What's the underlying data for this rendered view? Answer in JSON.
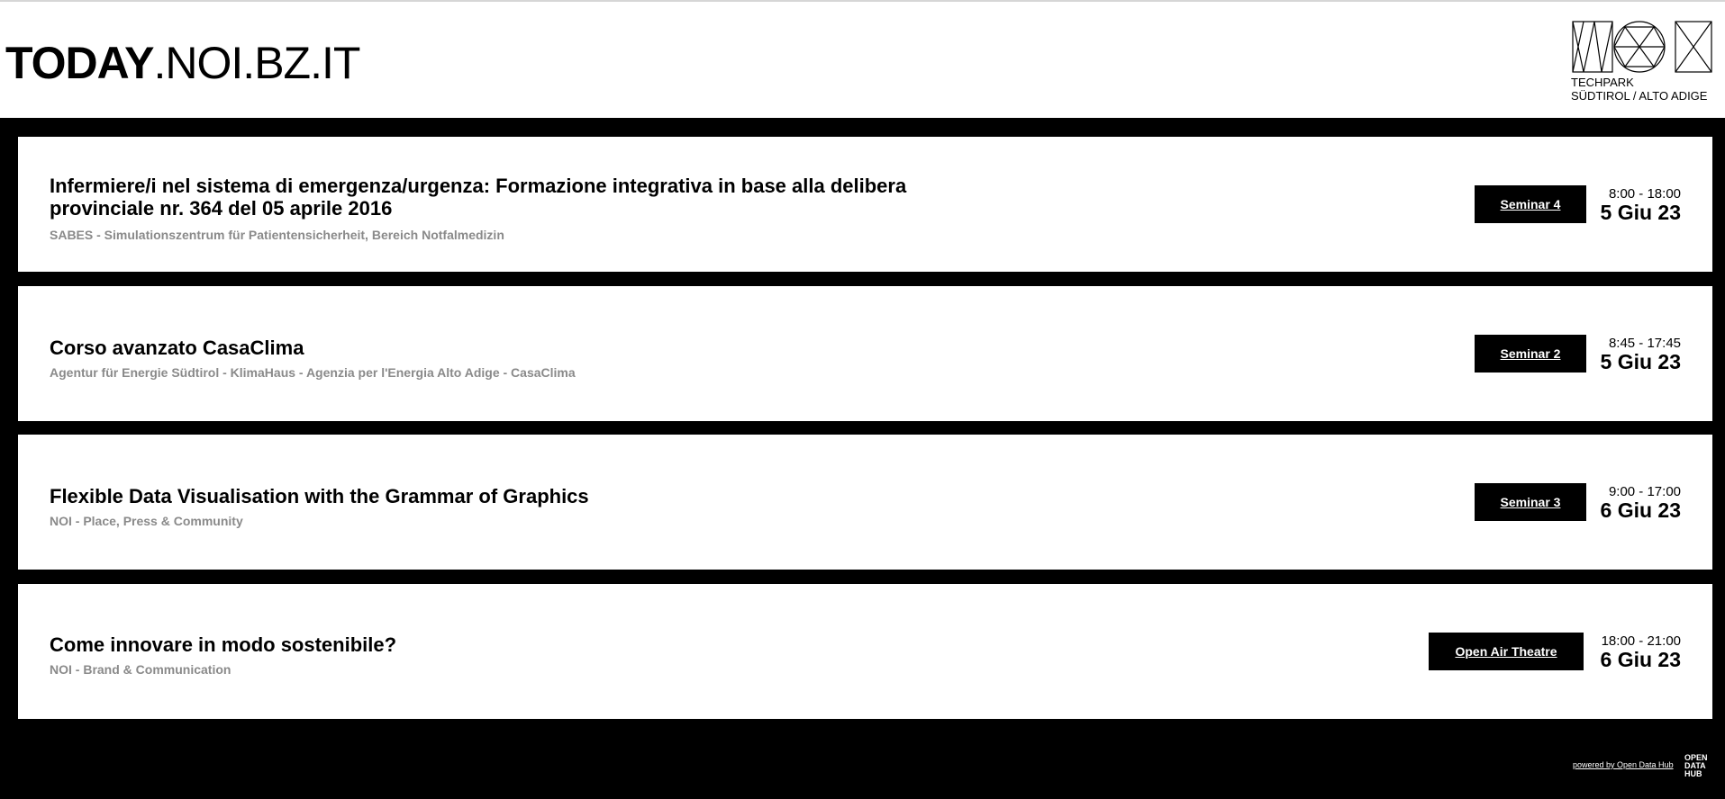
{
  "header": {
    "title_bold": "TODAY",
    "title_light": ".NOI.BZ.IT",
    "logo": {
      "icon": "noi-logo-icon",
      "line1": "TECHPARK",
      "line2": "SÜDTIROL / ALTO ADIGE"
    }
  },
  "events": [
    {
      "title": "Infermiere/i nel sistema di emergenza/urgenza: Formazione integrativa in base alla delibera provinciale nr. 364 del 05 aprile 2016",
      "organizer": "SABES - Simulationszentrum für Patientensicherheit, Bereich Notfalmedizin",
      "room": "Seminar 4",
      "time": "8:00 - 18:00",
      "date": "5 Giu 23"
    },
    {
      "title": "Corso avanzato CasaClima",
      "organizer": "Agentur für Energie Südtirol - KlimaHaus - Agenzia per l'Energia Alto Adige - CasaClima",
      "room": "Seminar 2",
      "time": "8:45 - 17:45",
      "date": "5 Giu 23"
    },
    {
      "title": "Flexible Data Visualisation with the Grammar of Graphics",
      "organizer": "NOI - Place, Press & Community",
      "room": "Seminar 3",
      "time": "9:00 - 17:00",
      "date": "6 Giu 23"
    },
    {
      "title": "Come innovare in modo sostenibile?",
      "organizer": "NOI - Brand & Communication",
      "room": "Open Air Theatre",
      "time": "18:00 - 21:00",
      "date": "6 Giu 23"
    }
  ],
  "footer": {
    "powered_by": "powered by Open Data Hub",
    "logo_lines": [
      "OPEN",
      "DATA",
      "HUB"
    ]
  },
  "colors": {
    "background": "#000000",
    "card": "#ffffff",
    "organizer_text": "#8a8a8a"
  }
}
